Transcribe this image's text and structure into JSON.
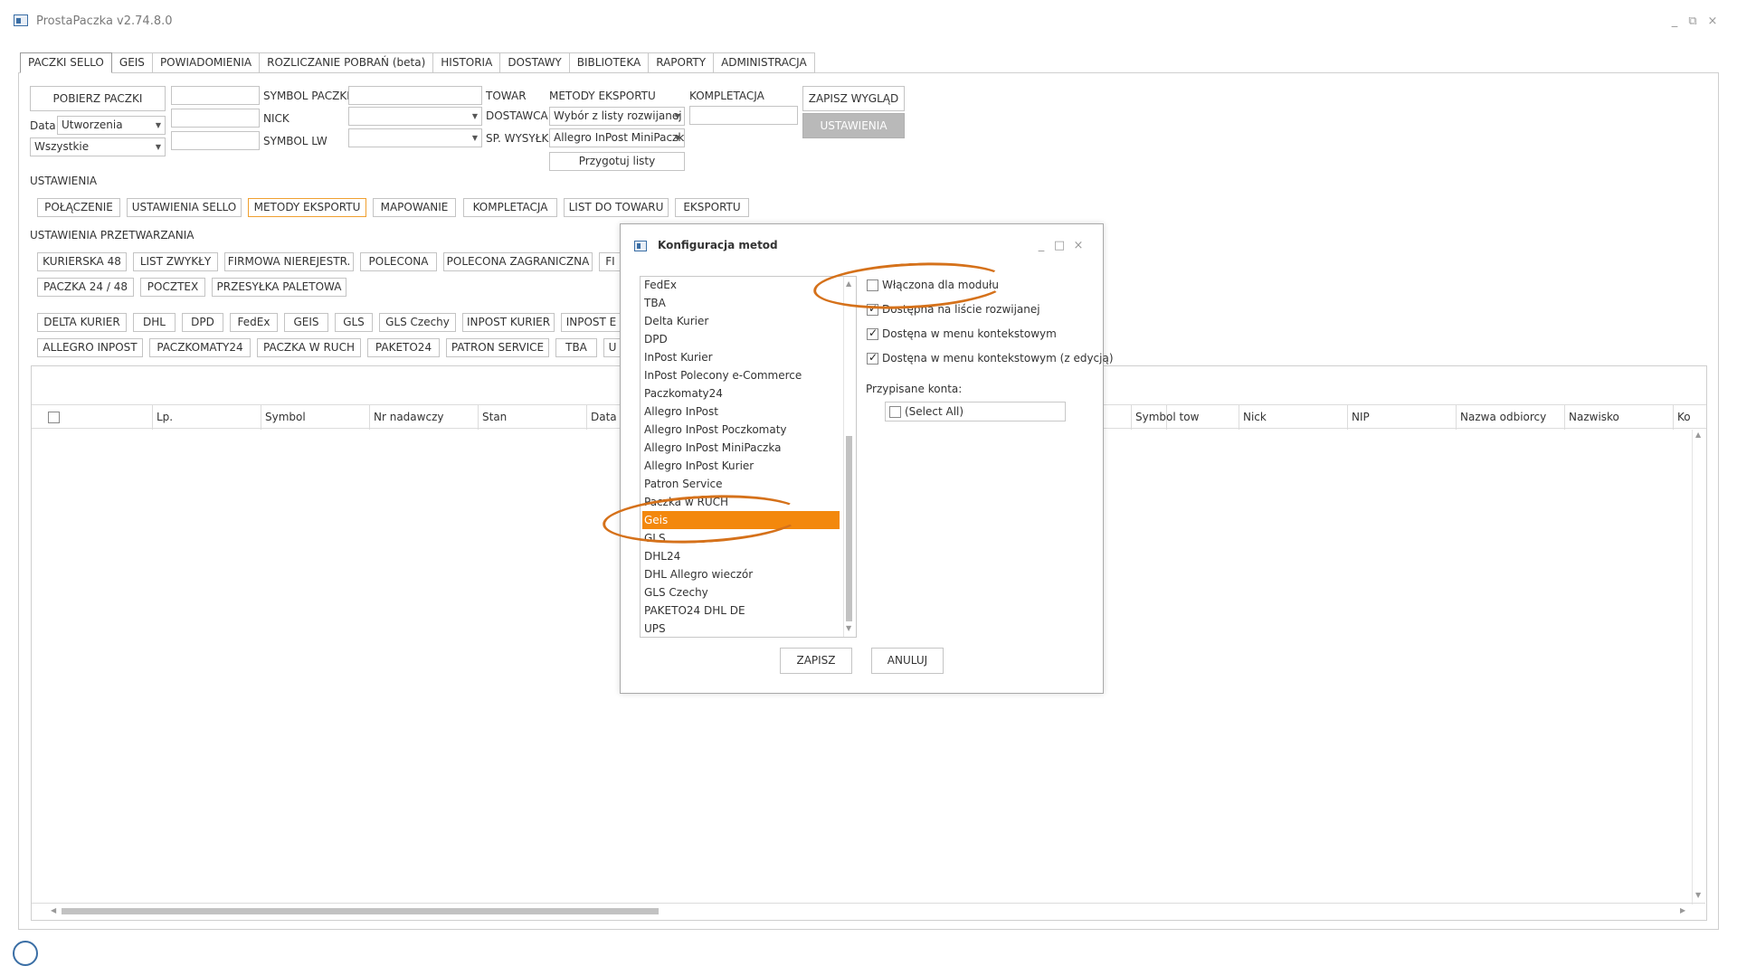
{
  "app": {
    "title": "ProstaPaczka v2.74.8.0",
    "window_controls": [
      "_",
      "⧉",
      "×"
    ]
  },
  "tabs": [
    {
      "label": "PACZKI SELLO",
      "active": true
    },
    {
      "label": "GEIS"
    },
    {
      "label": "POWIADOMIENIA"
    },
    {
      "label": "ROZLICZANIE POBRAŃ (beta)"
    },
    {
      "label": "HISTORIA"
    },
    {
      "label": "DOSTAWY"
    },
    {
      "label": "BIBLIOTEKA"
    },
    {
      "label": "RAPORTY"
    },
    {
      "label": "ADMINISTRACJA"
    }
  ],
  "filters": {
    "fetch_button": "POBIERZ PACZKI",
    "date_label": "Data:",
    "date_value": "Utworzenia",
    "status_value": "Wszystkie",
    "symbol_paczki_label": "SYMBOL PACZKI",
    "nick_label": "NICK",
    "symbol_lw_label": "SYMBOL LW",
    "towar_label": "TOWAR",
    "dostawca_label": "DOSTAWCA",
    "sp_wysylki_label": "SP. WYSYŁKI",
    "metody_eksportu_label": "METODY EKSPORTU",
    "metody_eksportu_value": "Wybór z listy rozwijanej",
    "sp_wysylki_value": "Allegro InPost MiniPaczk",
    "przygotuj_button": "Przygotuj listy",
    "kompletacja_label": "KOMPLETACJA",
    "zapisz_wyglad_button": "ZAPISZ WYGLĄD",
    "ustawienia_button": "USTAWIENIA"
  },
  "settings": {
    "section_label": "USTAWIENIA",
    "buttons": [
      "POŁĄCZENIE",
      "USTAWIENIA SELLO",
      "METODY EKSPORTU",
      "MAPOWANIE",
      "KOMPLETACJA",
      "LIST DO TOWARU",
      "EKSPORTU"
    ],
    "active_button": "METODY EKSPORTU"
  },
  "processing": {
    "section_label": "USTAWIENIA PRZETWARZANIA",
    "row1": [
      "KURIERSKA 48",
      "LIST ZWYKŁY",
      "FIRMOWA NIEREJESTR.",
      "POLECONA",
      "POLECONA ZAGRANICZNA",
      "FI"
    ],
    "row2": [
      "PACZKA 24 / 48",
      "POCZTEX",
      "PRZESYŁKA PALETOWA"
    ],
    "row3": [
      "DELTA KURIER",
      "DHL",
      "DPD",
      "FedEx",
      "GEIS",
      "GLS",
      "GLS Czechy",
      "INPOST KURIER",
      "INPOST E"
    ],
    "row4": [
      "ALLEGRO INPOST",
      "PACZKOMATY24",
      "PACZKA W RUCH",
      "PAKETO24",
      "PATRON SERVICE",
      "TBA",
      "U"
    ]
  },
  "grid": {
    "columns_left": [
      "Lp.",
      "Symbol",
      "Nr nadawczy",
      "Stan",
      "Data u"
    ],
    "columns_right": [
      "Symbol tow",
      "Nick",
      "NIP",
      "Nazwa odbiorcy",
      "Nazwisko",
      "Ko"
    ]
  },
  "dialog": {
    "title": "Konfiguracja metod",
    "controls": [
      "_",
      "□",
      "×"
    ],
    "methods": [
      "FedEx",
      "TBA",
      "Delta Kurier",
      "DPD",
      "InPost Kurier",
      "InPost Polecony e-Commerce",
      "Paczkomaty24",
      "Allegro InPost",
      "Allegro InPost Poczkomaty",
      "Allegro InPost MiniPaczka",
      "Allegro InPost Kurier",
      "Patron Service",
      "Paczka w RUCH",
      "Geis",
      "GLS",
      "DHL24",
      "DHL Allegro wieczór",
      "GLS Czechy",
      "PAKETO24 DHL DE",
      "UPS"
    ],
    "selected_method": "Geis",
    "options": [
      {
        "label": "Włączona dla modułu",
        "checked": false
      },
      {
        "label": "Dostępna na liście rozwijanej",
        "checked": true
      },
      {
        "label": "Dostęna w menu kontekstowym",
        "checked": true
      },
      {
        "label": "Dostęna w menu kontekstowym (z edycją)",
        "checked": true
      }
    ],
    "accounts_label": "Przypisane konta:",
    "select_all": "(Select All)",
    "save_button": "ZAPISZ",
    "cancel_button": "ANULUJ",
    "accent_color": "#f3880d",
    "annotation_color": "#d5711a"
  }
}
